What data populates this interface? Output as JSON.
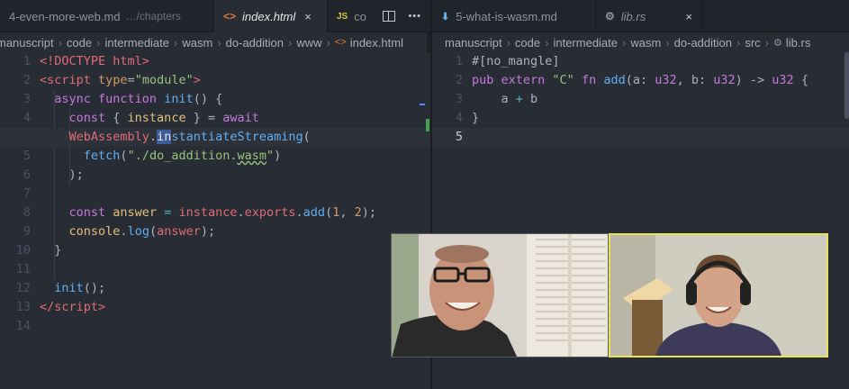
{
  "left_pane": {
    "tabs": [
      {
        "title": "4-even-more-web.md",
        "hint": "…/chapters",
        "active": false
      },
      {
        "title": "index.html",
        "icon": "<>",
        "active": true
      },
      {
        "title": "co",
        "icon": "JS",
        "active": false
      }
    ],
    "breadcrumbs": [
      "manuscript",
      "code",
      "intermediate",
      "wasm",
      "do-addition",
      "www",
      "index.html"
    ],
    "line_numbers": [
      "1",
      "2",
      "3",
      "4",
      "",
      "5",
      "6",
      "7",
      "8",
      "9",
      "10",
      "11",
      "12",
      "13",
      "14"
    ],
    "code_lines": [
      [
        "<!DOCTYPE html>"
      ],
      [
        "<script",
        " type",
        "=",
        "\"module\"",
        ">"
      ],
      [
        "async",
        " function",
        " init",
        "() {"
      ],
      [
        "const",
        " { ",
        "instance",
        " } = ",
        "await"
      ],
      [
        "WebAssembly",
        ".",
        "in",
        "stantiateStreaming",
        "("
      ],
      [
        "fetch",
        "(",
        "\"./do_addition.",
        "wasm",
        "\"",
        ")"
      ],
      [
        ");"
      ],
      [
        ""
      ],
      [
        "const",
        " answer",
        " = ",
        "instance",
        ".",
        "exports",
        ".",
        "add",
        "(",
        "1",
        ", ",
        "2",
        ");"
      ],
      [
        "console",
        ".",
        "log",
        "(",
        "answer",
        ");"
      ],
      [
        "}"
      ],
      [
        ""
      ],
      [
        "init",
        "();"
      ],
      [
        "</script",
        ">"
      ],
      [
        ""
      ]
    ]
  },
  "right_pane": {
    "tabs": [
      {
        "title": "5-what-is-wasm.md",
        "active": false
      },
      {
        "title": "lib.rs",
        "active": true
      }
    ],
    "breadcrumbs": [
      "manuscript",
      "code",
      "intermediate",
      "wasm",
      "do-addition",
      "src",
      "lib.rs"
    ],
    "line_numbers": [
      "1",
      "2",
      "3",
      "4",
      "5"
    ],
    "code_lines": [
      [
        "#[no_mangle]"
      ],
      [
        "pub",
        " extern",
        " \"C\"",
        " fn",
        " add",
        "(a: ",
        "u32",
        ", b: ",
        "u32",
        ") -> ",
        "u32",
        " {"
      ],
      [
        "a",
        " + ",
        "b"
      ],
      [
        "}"
      ],
      [
        ""
      ]
    ]
  },
  "tab_actions": {
    "more_label": "•••"
  },
  "close_glyph": "×",
  "crumb_separator": "›",
  "colors": {
    "keyword": "#c678dd",
    "tag": "#e06c75",
    "string": "#98c379",
    "function": "#61afef",
    "type": "#e5c07b",
    "accent": "#528bff",
    "webcam_highlight": "#e6e35b"
  }
}
